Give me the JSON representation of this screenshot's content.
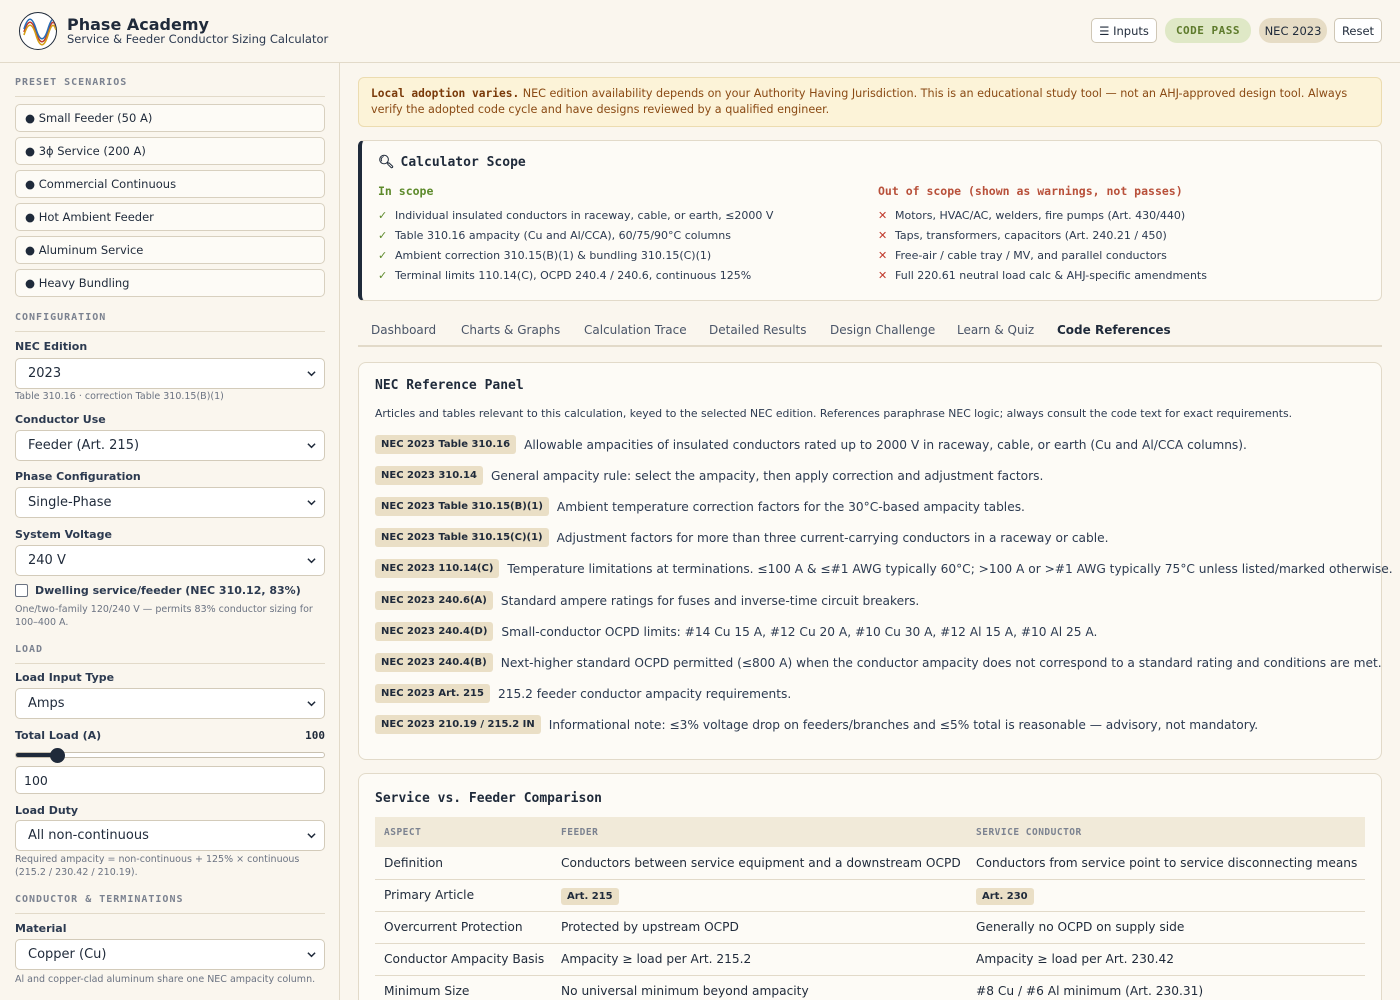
{
  "header": {
    "title": "Phase Academy",
    "subtitle": "Service & Feeder Conductor Sizing Calculator",
    "inputs_btn": "☰ Inputs",
    "code_pass": "CODE PASS",
    "nec_badge": "NEC 2023",
    "reset_btn": "Reset"
  },
  "sidebar": {
    "preset_heading": "PRESET SCENARIOS",
    "presets": [
      "● Small Feeder (50 A)",
      "● 3ϕ Service (200 A)",
      "● Commercial Continuous",
      "● Hot Ambient Feeder",
      "● Aluminum Service",
      "● Heavy Bundling"
    ],
    "config_heading": "CONFIGURATION",
    "nec_edition_label": "NEC Edition",
    "nec_edition_value": "2023",
    "nec_edition_hint": "Table 310.16 · correction Table 310.15(B)(1)",
    "conductor_use_label": "Conductor Use",
    "conductor_use_value": "Feeder (Art. 215)",
    "phase_label": "Phase Configuration",
    "phase_value": "Single-Phase",
    "voltage_label": "System Voltage",
    "voltage_value": "240 V",
    "dwelling_label": "Dwelling service/feeder (NEC 310.12, 83%)",
    "dwelling_checked": false,
    "dwelling_hint": "One/two-family 120/240 V — permits 83% conductor sizing for 100–400 A.",
    "load_heading": "LOAD",
    "load_type_label": "Load Input Type",
    "load_type_value": "Amps",
    "total_load_label": "Total Load (A)",
    "total_load_value": "100",
    "total_load_fraction": 0.135,
    "load_duty_label": "Load Duty",
    "load_duty_value": "All non-continuous",
    "load_duty_hint": "Required ampacity = non-continuous + 125% × continuous (215.2 / 230.42 / 210.19).",
    "conductor_heading": "CONDUCTOR & TERMINATIONS",
    "material_label": "Material",
    "material_value": "Copper (Cu)",
    "material_hint": "Al and copper-clad aluminum share one NEC ampacity column."
  },
  "banner": {
    "bold": "Local adoption varies.",
    "text": " NEC edition availability depends on your Authority Having Jurisdiction. This is an educational study tool — not an AHJ-approved design tool. Always verify the adopted code cycle and have designs reviewed by a qualified engineer."
  },
  "scope": {
    "title": "Calculator Scope",
    "in_heading": "In scope",
    "out_heading": "Out of scope (shown as warnings, not passes)",
    "in_items": [
      "Individual insulated conductors in raceway, cable, or earth, ≤2000 V",
      "Table 310.16 ampacity (Cu and Al/CCA), 60/75/90°C columns",
      "Ambient correction 310.15(B)(1) & bundling 310.15(C)(1)",
      "Terminal limits 110.14(C), OCPD 240.4 / 240.6, continuous 125%"
    ],
    "out_items": [
      "Motors, HVAC/AC, welders, fire pumps (Art. 430/440)",
      "Taps, transformers, capacitors (Art. 240.21 / 450)",
      "Free-air / cable tray / MV, and parallel conductors",
      "Full 220.61 neutral load calc & AHJ-specific amendments"
    ]
  },
  "tabs": [
    "Dashboard",
    "Charts & Graphs",
    "Calculation Trace",
    "Detailed Results",
    "Design Challenge",
    "Learn & Quiz",
    "Code References"
  ],
  "active_tab": "Code References",
  "refs": {
    "title": "NEC Reference Panel",
    "intro": "Articles and tables relevant to this calculation, keyed to the selected NEC edition. References paraphrase NEC logic; always consult the code text for exact requirements.",
    "items": [
      {
        "badge": "NEC 2023 Table 310.16",
        "text": "Allowable ampacities of insulated conductors rated up to 2000 V in raceway, cable, or earth (Cu and Al/CCA columns)."
      },
      {
        "badge": "NEC 2023 310.14",
        "text": "General ampacity rule: select the ampacity, then apply correction and adjustment factors."
      },
      {
        "badge": "NEC 2023 Table 310.15(B)(1)",
        "text": "Ambient temperature correction factors for the 30°C-based ampacity tables."
      },
      {
        "badge": "NEC 2023 Table 310.15(C)(1)",
        "text": "Adjustment factors for more than three current-carrying conductors in a raceway or cable."
      },
      {
        "badge": "NEC 2023 110.14(C)",
        "text": "Temperature limitations at terminations. ≤100 A & ≤#1 AWG typically 60°C; >100 A or >#1 AWG typically 75°C unless listed/marked otherwise."
      },
      {
        "badge": "NEC 2023 240.6(A)",
        "text": "Standard ampere ratings for fuses and inverse-time circuit breakers."
      },
      {
        "badge": "NEC 2023 240.4(D)",
        "text": "Small-conductor OCPD limits: #14 Cu 15 A, #12 Cu 20 A, #10 Cu 30 A, #12 Al 15 A, #10 Al 25 A."
      },
      {
        "badge": "NEC 2023 240.4(B)",
        "text": "Next-higher standard OCPD permitted (≤800 A) when the conductor ampacity does not correspond to a standard rating and conditions are met."
      },
      {
        "badge": "NEC 2023 Art. 215",
        "text": "215.2 feeder conductor ampacity requirements."
      },
      {
        "badge": "NEC 2023 210.19 / 215.2 IN",
        "text": "Informational note: ≤3% voltage drop on feeders/branches and ≤5% total is reasonable — advisory, not mandatory."
      }
    ]
  },
  "comparison": {
    "title": "Service vs. Feeder Comparison",
    "headers": [
      "ASPECT",
      "FEEDER",
      "SERVICE CONDUCTOR"
    ],
    "rows": [
      {
        "aspect": "Definition",
        "feeder": "Conductors between service equipment and a downstream OCPD",
        "service": "Conductors from service point to service disconnecting means"
      },
      {
        "aspect": "Primary Article",
        "feeder": "Art. 215",
        "service": "Art. 230"
      },
      {
        "aspect": "Overcurrent Protection",
        "feeder": "Protected by upstream OCPD",
        "service": "Generally no OCPD on supply side"
      },
      {
        "aspect": "Conductor Ampacity Basis",
        "feeder": "Ampacity ≥ load per Art. 215.2",
        "service": "Ampacity ≥ load per Art. 230.42"
      },
      {
        "aspect": "Minimum Size",
        "feeder": "No universal minimum beyond ampacity",
        "service": "#8 Cu / #6 Al minimum (Art. 230.31)"
      }
    ]
  }
}
